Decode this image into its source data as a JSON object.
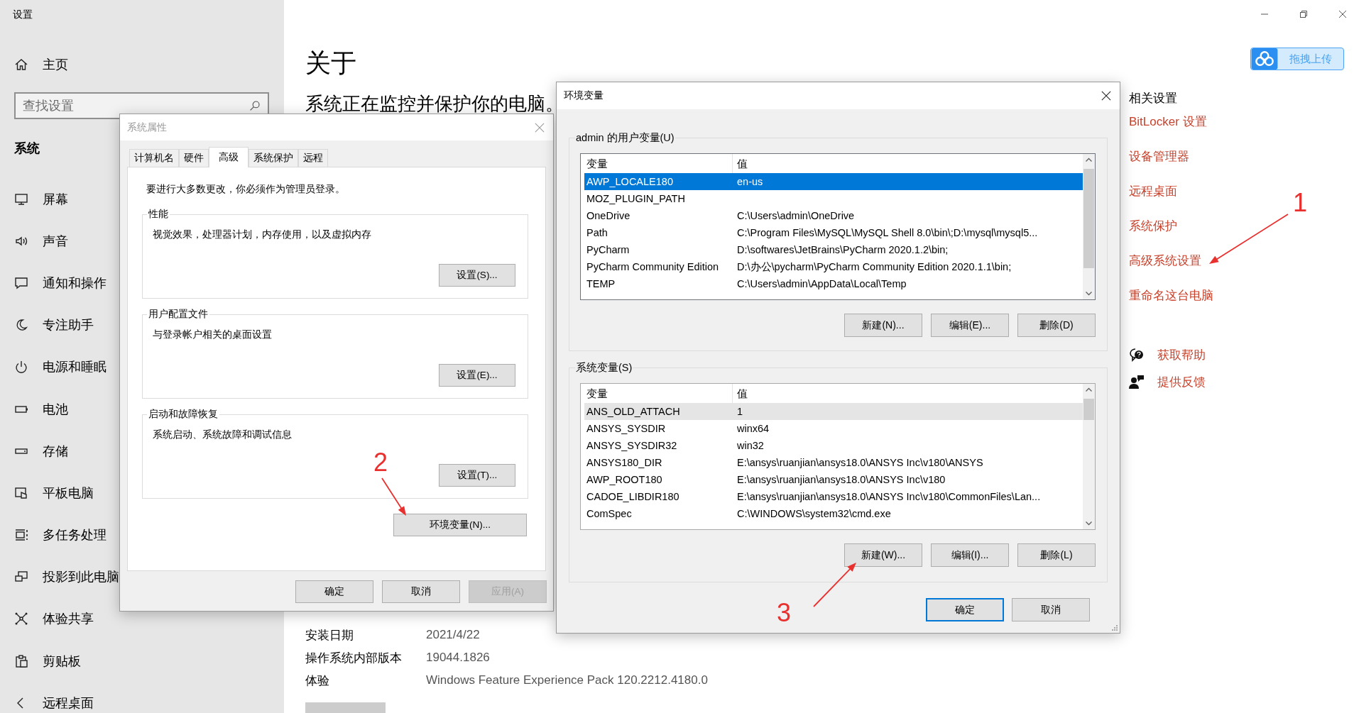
{
  "settings": {
    "title": "设置",
    "home": "主页",
    "search": {
      "placeholder": "查找设置"
    },
    "section": "系统",
    "nav_items": [
      {
        "label": "屏幕"
      },
      {
        "label": "声音"
      },
      {
        "label": "通知和操作"
      },
      {
        "label": "专注助手"
      },
      {
        "label": "电源和睡眠"
      },
      {
        "label": "电池"
      },
      {
        "label": "存储"
      },
      {
        "label": "平板电脑"
      },
      {
        "label": "多任务处理"
      },
      {
        "label": "投影到此电脑"
      },
      {
        "label": "体验共享"
      },
      {
        "label": "剪贴板"
      },
      {
        "label": "远程桌面"
      }
    ]
  },
  "about": {
    "heading": "关于",
    "status": "系统正在监控并保护你的电脑。",
    "specs": [
      {
        "label": "安装日期",
        "value": "2021/4/22"
      },
      {
        "label": "操作系统内部版本",
        "value": "19044.1826"
      },
      {
        "label": "体验",
        "value": "Windows Feature Experience Pack 120.2212.4180.0"
      }
    ]
  },
  "upload_button": {
    "label": "拖拽上传"
  },
  "related_settings": {
    "title": "相关设置",
    "links": [
      "BitLocker 设置",
      "设备管理器",
      "远程桌面",
      "系统保护",
      "高级系统设置",
      "重命名这台电脑"
    ]
  },
  "help_links": [
    {
      "label": "获取帮助",
      "kind": "help"
    },
    {
      "label": "提供反馈",
      "kind": "feedback"
    }
  ],
  "system_properties": {
    "title": "系统属性",
    "active": false,
    "tabs": [
      {
        "label": "计算机名",
        "selected": false
      },
      {
        "label": "硬件",
        "selected": false
      },
      {
        "label": "高级",
        "selected": true
      },
      {
        "label": "系统保护",
        "selected": false
      },
      {
        "label": "远程",
        "selected": false
      }
    ],
    "notice": "要进行大多数更改，你必须作为管理员登录。",
    "groups": [
      {
        "title": "性能",
        "description": "视觉效果，处理器计划，内存使用，以及虚拟内存",
        "button": "设置(S)..."
      },
      {
        "title": "用户配置文件",
        "description": "与登录帐户相关的桌面设置",
        "button": "设置(E)..."
      },
      {
        "title": "启动和故障恢复",
        "description": "系统启动、系统故障和调试信息",
        "button": "设置(T)..."
      }
    ],
    "env_button": "环境变量(N)...",
    "buttons": [
      {
        "label": "确定",
        "disabled": false
      },
      {
        "label": "取消",
        "disabled": false
      },
      {
        "label": "应用(A)",
        "disabled": true
      }
    ]
  },
  "env_vars": {
    "title": "环境变量",
    "active": true,
    "sections": [
      {
        "title": "admin 的用户变量(U)",
        "focused": true,
        "columns": [
          "变量",
          "值"
        ],
        "rows": [
          {
            "name": "AWP_LOCALE180",
            "value": "en-us",
            "selected": true
          },
          {
            "name": "MOZ_PLUGIN_PATH",
            "value": "",
            "selected": false
          },
          {
            "name": "OneDrive",
            "value": "C:\\Users\\admin\\OneDrive",
            "selected": false
          },
          {
            "name": "Path",
            "value": "C:\\Program Files\\MySQL\\MySQL Shell 8.0\\bin\\;D:\\mysql\\mysql5...",
            "selected": false
          },
          {
            "name": "PyCharm",
            "value": "D:\\softwares\\JetBrains\\PyCharm 2020.1.2\\bin;",
            "selected": false
          },
          {
            "name": "PyCharm Community Edition",
            "value": "D:\\办公\\pycharm\\PyCharm Community Edition 2020.1.1\\bin;",
            "selected": false
          },
          {
            "name": "TEMP",
            "value": "C:\\Users\\admin\\AppData\\Local\\Temp",
            "selected": false
          }
        ],
        "buttons": [
          "新建(N)...",
          "编辑(E)...",
          "删除(D)"
        ]
      },
      {
        "title": "系统变量(S)",
        "focused": false,
        "columns": [
          "变量",
          "值"
        ],
        "rows": [
          {
            "name": "ANS_OLD_ATTACH",
            "value": "1",
            "selected": true
          },
          {
            "name": "ANSYS_SYSDIR",
            "value": "winx64",
            "selected": false
          },
          {
            "name": "ANSYS_SYSDIR32",
            "value": "win32",
            "selected": false
          },
          {
            "name": "ANSYS180_DIR",
            "value": "E:\\ansys\\ruanjian\\ansys18.0\\ANSYS Inc\\v180\\ANSYS",
            "selected": false
          },
          {
            "name": "AWP_ROOT180",
            "value": "E:\\ansys\\ruanjian\\ansys18.0\\ANSYS Inc\\v180",
            "selected": false
          },
          {
            "name": "CADOE_LIBDIR180",
            "value": "E:\\ansys\\ruanjian\\ansys18.0\\ANSYS Inc\\v180\\CommonFiles\\Lan...",
            "selected": false
          },
          {
            "name": "ComSpec",
            "value": "C:\\WINDOWS\\system32\\cmd.exe",
            "selected": false
          }
        ],
        "buttons": [
          "新建(W)...",
          "编辑(I)...",
          "删除(L)"
        ]
      }
    ],
    "buttons": [
      {
        "label": "确定",
        "default": true
      },
      {
        "label": "取消",
        "default": false
      }
    ]
  },
  "annotations": [
    {
      "label": "1"
    },
    {
      "label": "2"
    },
    {
      "label": "3"
    }
  ]
}
